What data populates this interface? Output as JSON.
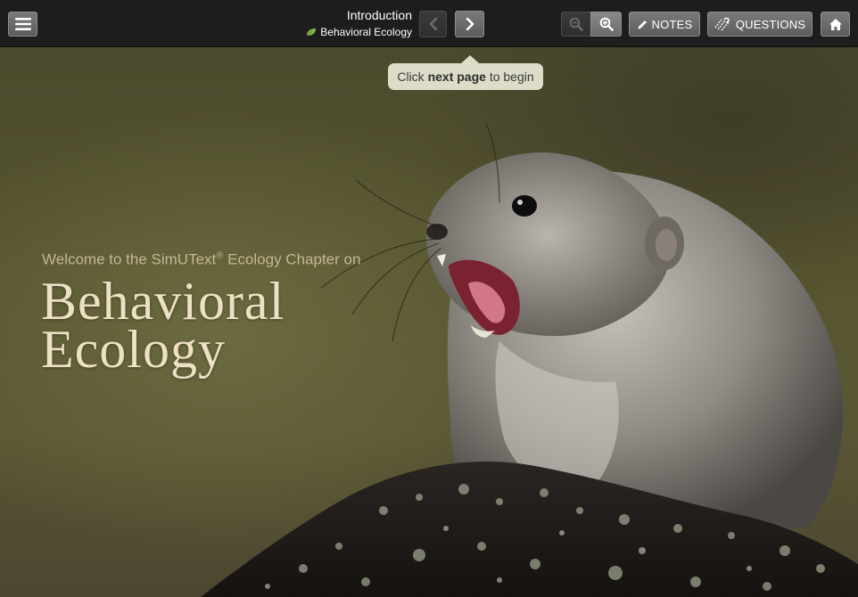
{
  "header": {
    "title": "Introduction",
    "subtitle": "Behavioral Ecology",
    "notes_label": "NOTES",
    "questions_label": "QUESTIONS"
  },
  "icons": {
    "menu": "hamburger-menu-icon",
    "prev": "chevron-left-icon",
    "next": "chevron-right-icon",
    "zoom_out": "zoom-out-icon",
    "zoom_in": "zoom-in-icon",
    "notes": "pencil-icon",
    "questions": "questions-icon",
    "home": "home-icon",
    "section": "leaf-icon"
  },
  "tooltip": {
    "prefix": "Click",
    "bold": "next page",
    "suffix": "to begin"
  },
  "hero": {
    "welcome_prefix": "Welcome to the SimUText",
    "registered": "®",
    "welcome_suffix": "Ecology Chapter on",
    "title_line1": "Behavioral",
    "title_line2": "Ecology"
  },
  "colors": {
    "toolbar_bg": "#1d1d1d",
    "title_text": "#ede0c4",
    "welcome_text": "#c4b795",
    "tooltip_bg": "#dcdcc8",
    "leaf_green": "#8cc04b"
  }
}
